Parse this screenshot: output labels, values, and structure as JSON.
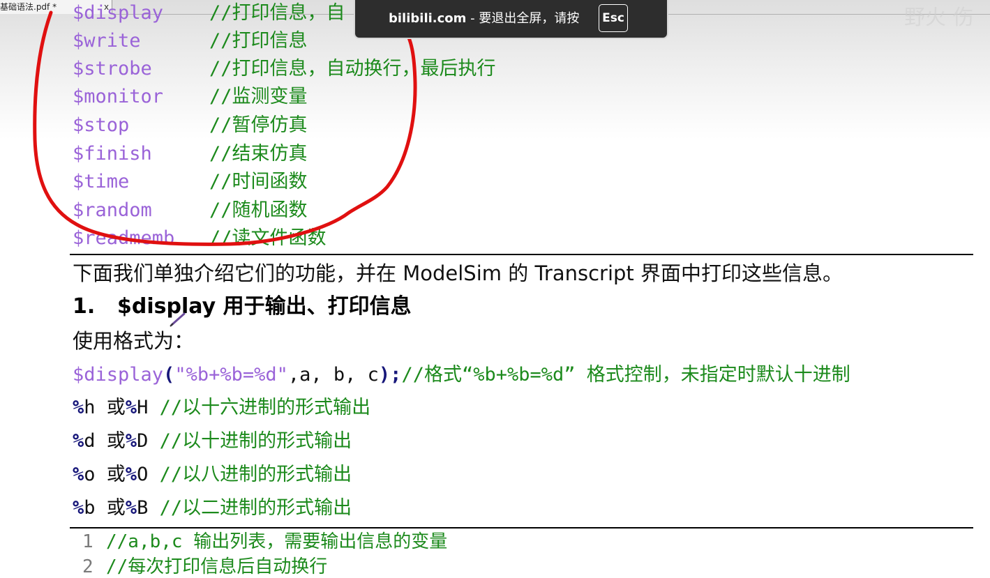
{
  "tab": {
    "title": "基础语法.pdf *",
    "close": "x"
  },
  "toast": {
    "site": "bilibili.com",
    "sep": " - ",
    "message": "要退出全屏，请按",
    "key": "Esc"
  },
  "watermark": "野火  伤",
  "syscalls": [
    {
      "name": "$display",
      "comment": "//打印信息，自"
    },
    {
      "name": "$write",
      "comment": "//打印信息"
    },
    {
      "name": "$strobe",
      "comment": "//打印信息，自动换行，最后执行"
    },
    {
      "name": "$monitor",
      "comment": "//监测变量"
    },
    {
      "name": "$stop",
      "comment": "//暂停仿真"
    },
    {
      "name": "$finish",
      "comment": "//结束仿真"
    },
    {
      "name": "$time",
      "comment": "//时间函数"
    },
    {
      "name": "$random",
      "comment": "//随机函数"
    },
    {
      "name": "$readmemb",
      "comment": "//读文件函数"
    }
  ],
  "intro": "下面我们单独介绍它们的功能，并在 ModelSim 的 Transcript 界面中打印这些信息。",
  "section": {
    "number": "1.",
    "keyword": "$display",
    "title": " 用于输出、打印信息"
  },
  "usage": "使用格式为：",
  "example": {
    "func": "$display",
    "open": "(",
    "fmt": "\"%b+%b=%d\"",
    "args": ",a, b, c",
    "close": ");",
    "comment": "//格式“%b+%b=%d” 格式控制，未指定时默认十进制"
  },
  "formats": [
    {
      "p1": "%",
      "l1": "h",
      "or": " 或",
      "p2": "%",
      "l2": "H",
      "comment": " //以十六进制的形式输出"
    },
    {
      "p1": "%",
      "l1": "d",
      "or": " 或",
      "p2": "%",
      "l2": "D",
      "comment": " //以十进制的形式输出"
    },
    {
      "p1": "%",
      "l1": "o",
      "or": " 或",
      "p2": "%",
      "l2": "O",
      "comment": " //以八进制的形式输出"
    },
    {
      "p1": "%",
      "l1": "b",
      "or": " 或",
      "p2": "%",
      "l2": "B",
      "comment": " //以二进制的形式输出"
    }
  ],
  "code_lines": [
    {
      "num": "1",
      "text": "//a,b,c 输出列表，需要输出信息的变量"
    },
    {
      "num": "2",
      "text": "//每次打印信息后自动换行"
    }
  ],
  "colors": {
    "keyword": "#9a63d8",
    "comment": "#1c8a1c",
    "format": "#17177a",
    "annotation": "#e01010"
  },
  "icons": [
    "pen-cursor-icon",
    "tab-close-icon"
  ]
}
